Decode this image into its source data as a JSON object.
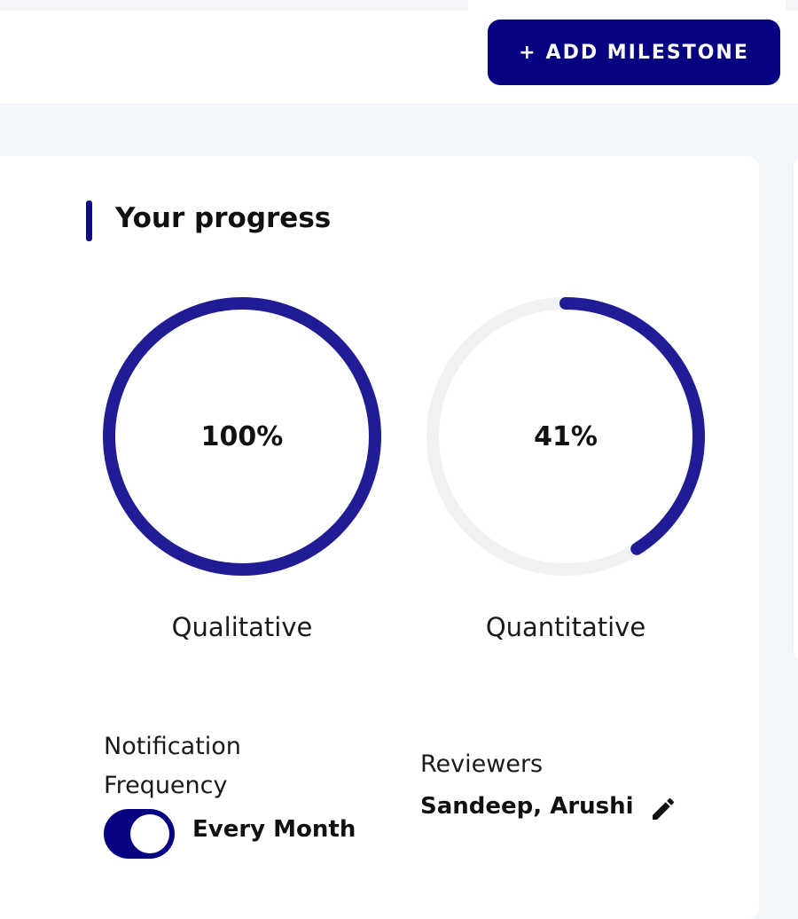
{
  "toolbar": {
    "add_milestone_plus": "+",
    "add_milestone_label": "ADD MILESTONE"
  },
  "progress": {
    "title": "Your progress",
    "gauges": [
      {
        "label": "Qualitative",
        "value_text": "100%",
        "fraction": 1.0
      },
      {
        "label": "Quantitative",
        "value_text": "41%",
        "fraction": 0.41
      }
    ]
  },
  "notification": {
    "label": "Notification Frequency",
    "toggle_on": true,
    "value": "Every Month"
  },
  "reviewers": {
    "label": "Reviewers",
    "value": "Sandeep, Arushi",
    "edit_icon": "pencil-icon"
  },
  "colors": {
    "accent": "#05037f",
    "gauge_stroke": "#201c96",
    "gauge_track": "#f1f1f3",
    "background": "#f3f6fb",
    "card": "#ffffff"
  }
}
